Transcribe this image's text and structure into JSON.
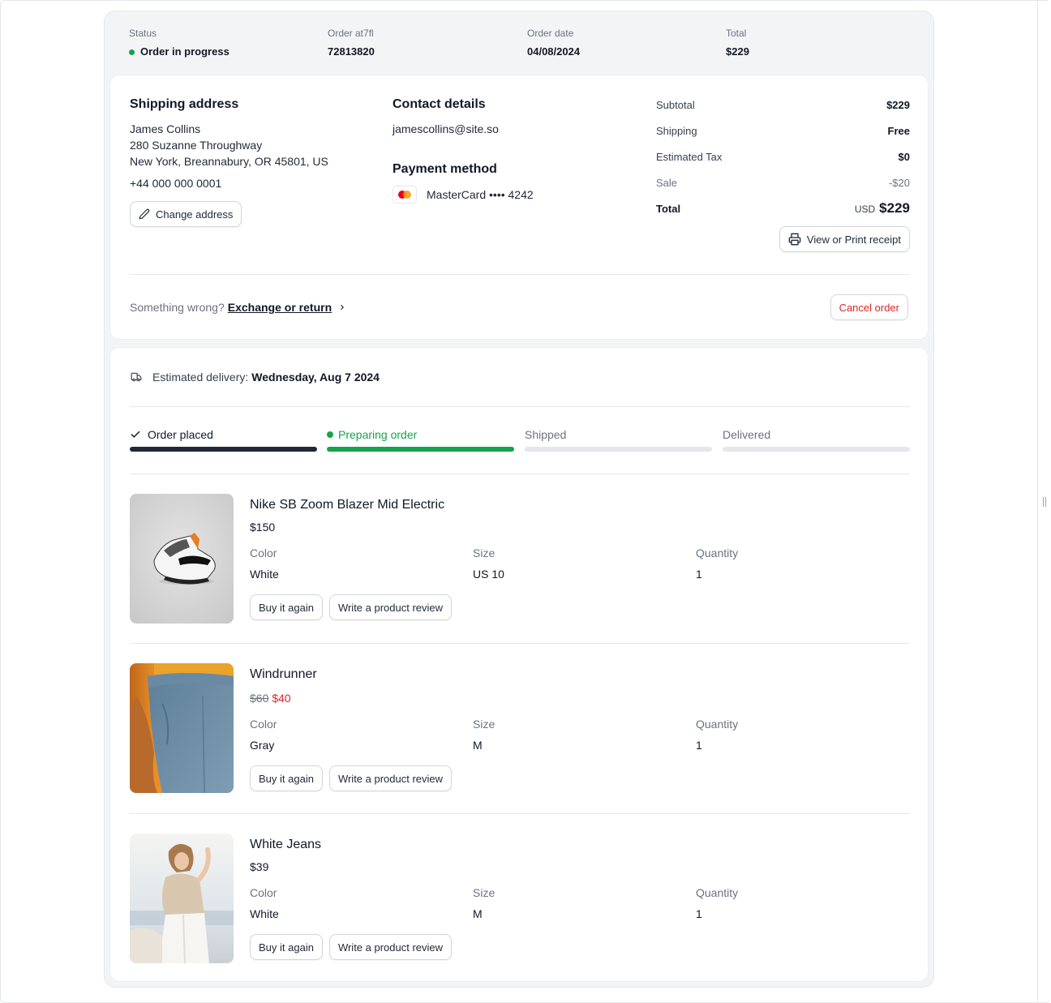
{
  "order": {
    "status_label": "Status",
    "status_value": "Order in progress",
    "order_label": "Order at7fl",
    "order_value": "72813820",
    "date_label": "Order date",
    "date_value": "04/08/2024",
    "total_label": "Total",
    "total_value": "$229"
  },
  "shipping": {
    "title": "Shipping address",
    "name": "James Collins",
    "street": "280 Suzanne Throughway",
    "city": "New York, Breannabury, OR 45801, US",
    "phone": "+44 000 000 0001",
    "change_button": "Change address"
  },
  "contact": {
    "title": "Contact details",
    "email": "jamescollins@site.so"
  },
  "payment": {
    "title": "Payment method",
    "card": "MasterCard •••• 4242"
  },
  "summary": {
    "subtotal_label": "Subtotal",
    "subtotal_value": "$229",
    "shipping_label": "Shipping",
    "shipping_value": "Free",
    "tax_label": "Estimated Tax",
    "tax_value": "$0",
    "sale_label": "Sale",
    "sale_value": "-$20",
    "total_label": "Total",
    "total_currency": "USD",
    "total_value": "$229",
    "receipt_button": "View or Print receipt"
  },
  "issue": {
    "prompt": "Something wrong?",
    "link": "Exchange or return",
    "cancel_button": "Cancel order"
  },
  "delivery": {
    "label": "Estimated delivery:",
    "date": "Wednesday, Aug 7 2024"
  },
  "steps": [
    {
      "label": "Order placed",
      "state": "done"
    },
    {
      "label": "Preparing order",
      "state": "active"
    },
    {
      "label": "Shipped",
      "state": "todo"
    },
    {
      "label": "Delivered",
      "state": "todo"
    }
  ],
  "attr_labels": {
    "color": "Color",
    "size": "Size",
    "quantity": "Quantity"
  },
  "product_buttons": {
    "buy_again": "Buy it again",
    "review": "Write a product review"
  },
  "products": [
    {
      "name": "Nike SB Zoom Blazer Mid Electric",
      "price": "$150",
      "color": "White",
      "size": "US 10",
      "quantity": "1"
    },
    {
      "name": "Windrunner",
      "old_price": "$60",
      "price": "$40",
      "color": "Gray",
      "size": "M",
      "quantity": "1"
    },
    {
      "name": "White Jeans",
      "price": "$39",
      "color": "White",
      "size": "M",
      "quantity": "1"
    }
  ],
  "colors": {
    "accent_green": "#16a34a",
    "danger_red": "#dc2626",
    "dark": "#1f2937"
  }
}
